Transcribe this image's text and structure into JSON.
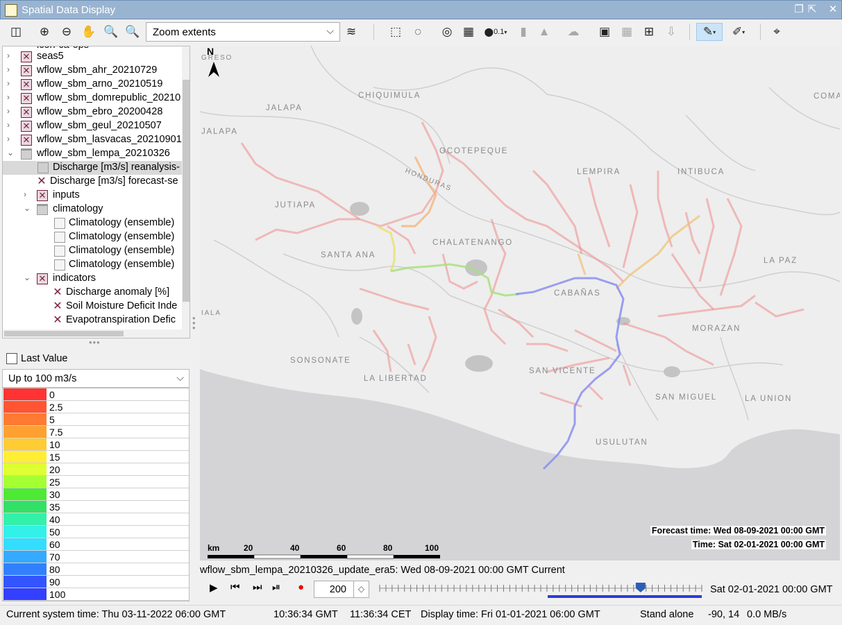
{
  "window": {
    "title": "Spatial Data Display",
    "controls": [
      "restore",
      "detach",
      "minimize",
      "close"
    ]
  },
  "toolbar": {
    "zoom_select_value": "Zoom extents",
    "point_size_label": "0.1"
  },
  "tree": {
    "partial_top_item": "icon-ca-ops",
    "items": [
      {
        "label": "seas5"
      },
      {
        "label": "wflow_sbm_ahr_20210729"
      },
      {
        "label": "wflow_sbm_arno_20210519"
      },
      {
        "label": "wflow_sbm_domrepublic_20210"
      },
      {
        "label": "wflow_sbm_ebro_20200428"
      },
      {
        "label": "wflow_sbm_geul_20210507"
      },
      {
        "label": "wflow_sbm_lasvacas_20210901"
      },
      {
        "label": "wflow_sbm_lempa_20210326"
      },
      {
        "label": "Discharge [m3/s] reanalysis-"
      },
      {
        "label": "Discharge [m3/s] forecast-se"
      },
      {
        "label": "inputs"
      },
      {
        "label": "climatology"
      },
      {
        "label": "Climatology (ensemble)"
      },
      {
        "label": "Climatology (ensemble)"
      },
      {
        "label": "Climatology (ensemble)"
      },
      {
        "label": "Climatology (ensemble)"
      },
      {
        "label": "indicators"
      },
      {
        "label": "Discharge anomaly [%]"
      },
      {
        "label": "Soil Moisture Deficit Inde"
      },
      {
        "label": "Evapotranspiration Defic"
      }
    ]
  },
  "legend_panel": {
    "last_value_label": "Last Value",
    "last_value_checked": false,
    "range_select_value": "Up to 100 m3/s",
    "entries": [
      {
        "value": "0",
        "color": "#ff3333"
      },
      {
        "value": "2.5",
        "color": "#ff5533"
      },
      {
        "value": "5",
        "color": "#ff7a33"
      },
      {
        "value": "7.5",
        "color": "#ffa033"
      },
      {
        "value": "10",
        "color": "#ffcc33"
      },
      {
        "value": "15",
        "color": "#ffee33"
      },
      {
        "value": "20",
        "color": "#ddff33"
      },
      {
        "value": "25",
        "color": "#a6ff33"
      },
      {
        "value": "30",
        "color": "#4cea33"
      },
      {
        "value": "35",
        "color": "#33e066"
      },
      {
        "value": "40",
        "color": "#33f0aa"
      },
      {
        "value": "50",
        "color": "#33f0e8"
      },
      {
        "value": "60",
        "color": "#33ddff"
      },
      {
        "value": "70",
        "color": "#33aaff"
      },
      {
        "value": "80",
        "color": "#3380ff"
      },
      {
        "value": "90",
        "color": "#3355ff"
      },
      {
        "value": "100",
        "color": "#3340ff"
      }
    ]
  },
  "map": {
    "north_label": "N",
    "place_labels": [
      "GRESO",
      "CHIQUIMULA",
      "JALAPA",
      "JALAPA",
      "OCOTEPEQUE",
      "HONDURAS",
      "LEMPIRA",
      "INTIBUCA",
      "COMAY",
      "JUTIAPA",
      "CHALATENANGO",
      "SANTA ANA",
      "LA PAZ",
      "CABAÑAS",
      "MORAZAN",
      "SONSONATE",
      "LA LIBERTAD",
      "SAN VICENTE",
      "SAN MIGUEL",
      "LA UNION",
      "USULUTAN",
      "IALA"
    ],
    "forecast_time": "Forecast time: Wed 08-09-2021 00:00 GMT",
    "time": "Time: Sat 02-01-2021 00:00 GMT",
    "scale_unit": "km",
    "scale_ticks": [
      "20",
      "40",
      "60",
      "80",
      "100"
    ]
  },
  "series_info": "wflow_sbm_lempa_20210326_update_era5: Wed 08-09-2021 00:00 GMT Current",
  "playback": {
    "step_value": "200",
    "timeline_time": "Sat 02-01-2021 00:00 GMT",
    "slider_position": 0.81
  },
  "statusbar": {
    "system_time": "Current system time: Thu 03-11-2022 06:00 GMT",
    "gmt_clock": "10:36:34 GMT",
    "cet_clock": "11:36:34 CET",
    "display_time": "Display time: Fri 01-01-2021 06:00 GMT",
    "mode": "Stand alone",
    "coords": "-90, 14",
    "rate": "0.0 MB/s"
  }
}
